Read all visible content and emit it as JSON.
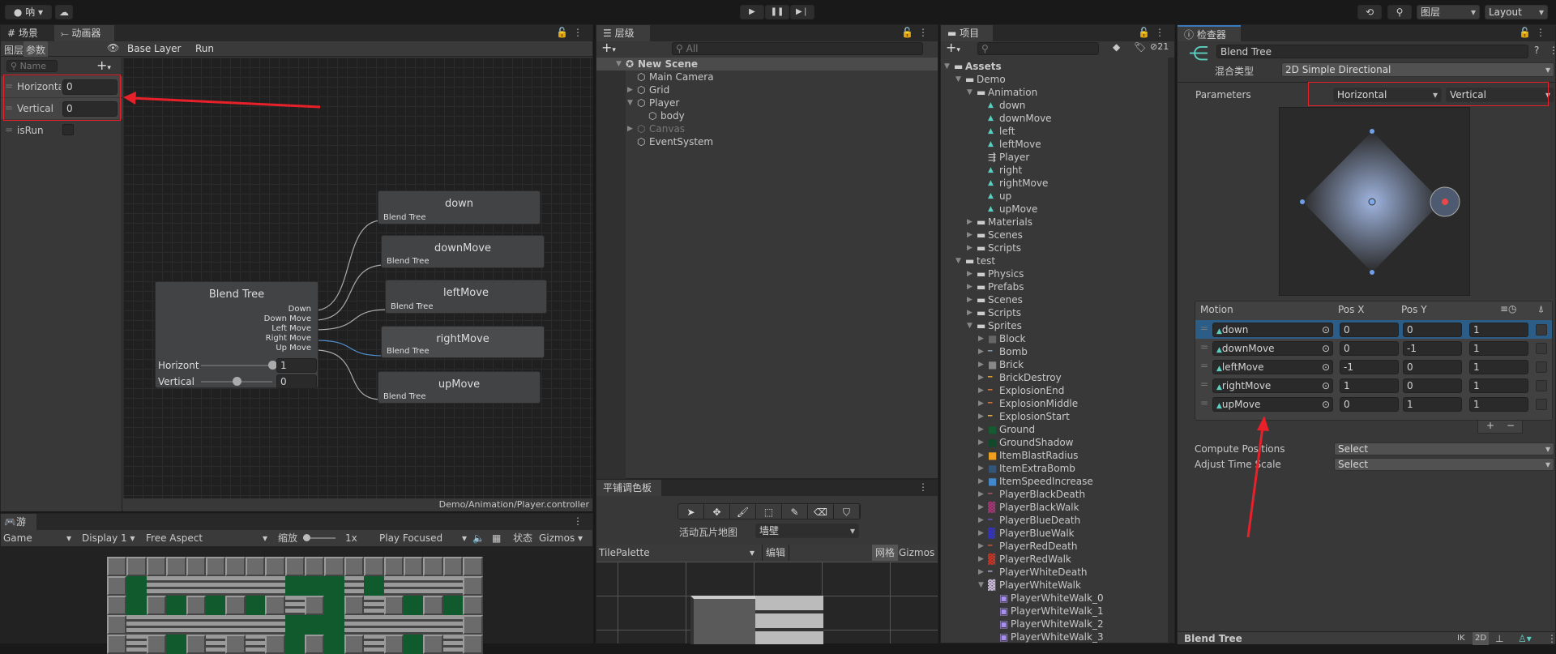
{
  "toolbar": {
    "account": "呐",
    "layers": "图层",
    "layout": "Layout",
    "play_icon": "play",
    "pause_icon": "pause",
    "step_icon": "step"
  },
  "animator": {
    "tabs": [
      "场景",
      "动画器"
    ],
    "subtabs": [
      "图层",
      "参数"
    ],
    "breadcrumb": [
      "Base Layer",
      "Run"
    ],
    "search_placeholder": "Name",
    "params": [
      {
        "name": "Horizontal",
        "value": "0"
      },
      {
        "name": "Vertical",
        "value": "0"
      },
      {
        "name": "isRun",
        "value": ""
      }
    ],
    "footer_path": "Demo/Animation/Player.controller",
    "blend_node": {
      "title": "Blend Tree",
      "outputs": [
        "Down",
        "Down Move",
        "Left Move",
        "Right Move",
        "Up Move"
      ],
      "sliders": [
        {
          "label": "Horizont",
          "value": "1",
          "fraction": 1
        },
        {
          "label": "Vertical",
          "value": "0",
          "fraction": 0.5
        }
      ]
    },
    "motion_nodes": [
      {
        "title": "down",
        "sub": "Blend Tree"
      },
      {
        "title": "downMove",
        "sub": "Blend Tree"
      },
      {
        "title": "leftMove",
        "sub": "Blend Tree"
      },
      {
        "title": "rightMove",
        "sub": "Blend Tree"
      },
      {
        "title": "upMove",
        "sub": "Blend Tree"
      }
    ]
  },
  "game": {
    "tab": "游戏",
    "display_mode": "Game",
    "display": "Display 1",
    "aspect": "Free Aspect",
    "scale_label": "缩放",
    "scale_value": "1x",
    "play_mode": "Play Focused",
    "stats": "状态",
    "gizmos": "Gizmos"
  },
  "hierarchy": {
    "tab": "层级",
    "search_placeholder": "All",
    "items": [
      {
        "label": "New Scene",
        "depth": 0,
        "arrow": "▼"
      },
      {
        "label": "Main Camera",
        "depth": 1,
        "arrow": ""
      },
      {
        "label": "Grid",
        "depth": 1,
        "arrow": "▶"
      },
      {
        "label": "Player",
        "depth": 1,
        "arrow": "▼"
      },
      {
        "label": "body",
        "depth": 2,
        "arrow": ""
      },
      {
        "label": "Canvas",
        "depth": 1,
        "arrow": "▶"
      },
      {
        "label": "EventSystem",
        "depth": 1,
        "arrow": ""
      }
    ]
  },
  "tile_palette": {
    "tab": "平铺调色板",
    "active_tilemap_label": "活动瓦片地图",
    "active_tilemap": "墙壁",
    "palette": "TilePalette",
    "edit": "编辑",
    "grid": "网格",
    "gizmos": "Gizmos",
    "tools": [
      "select",
      "move",
      "paint",
      "box-fill",
      "pick",
      "erase",
      "fill"
    ]
  },
  "project": {
    "tab": "项目",
    "hidden_count": "21",
    "items": [
      {
        "label": "Assets",
        "depth": 0,
        "arrow": "▼",
        "type": "folder"
      },
      {
        "label": "Demo",
        "depth": 1,
        "arrow": "▼",
        "type": "folder"
      },
      {
        "label": "Animation",
        "depth": 2,
        "arrow": "▼",
        "type": "folder"
      },
      {
        "label": "down",
        "depth": 3,
        "arrow": "",
        "type": "anim"
      },
      {
        "label": "downMove",
        "depth": 3,
        "arrow": "",
        "type": "anim"
      },
      {
        "label": "left",
        "depth": 3,
        "arrow": "",
        "type": "anim"
      },
      {
        "label": "leftMove",
        "depth": 3,
        "arrow": "",
        "type": "anim"
      },
      {
        "label": "Player",
        "depth": 3,
        "arrow": "",
        "type": "controller"
      },
      {
        "label": "right",
        "depth": 3,
        "arrow": "",
        "type": "anim"
      },
      {
        "label": "rightMove",
        "depth": 3,
        "arrow": "",
        "type": "anim"
      },
      {
        "label": "up",
        "depth": 3,
        "arrow": "",
        "type": "anim"
      },
      {
        "label": "upMove",
        "depth": 3,
        "arrow": "",
        "type": "anim"
      },
      {
        "label": "Materials",
        "depth": 2,
        "arrow": "▶",
        "type": "folder"
      },
      {
        "label": "Scenes",
        "depth": 2,
        "arrow": "▶",
        "type": "folder"
      },
      {
        "label": "Scripts",
        "depth": 2,
        "arrow": "▶",
        "type": "folder"
      },
      {
        "label": "test",
        "depth": 1,
        "arrow": "▼",
        "type": "folder"
      },
      {
        "label": "Physics",
        "depth": 2,
        "arrow": "▶",
        "type": "folder"
      },
      {
        "label": "Prefabs",
        "depth": 2,
        "arrow": "▶",
        "type": "folder"
      },
      {
        "label": "Scenes",
        "depth": 2,
        "arrow": "▶",
        "type": "folder"
      },
      {
        "label": "Scripts",
        "depth": 2,
        "arrow": "▶",
        "type": "folder"
      },
      {
        "label": "Sprites",
        "depth": 2,
        "arrow": "▼",
        "type": "folder"
      },
      {
        "label": "Block",
        "depth": 3,
        "arrow": "▶",
        "type": "sprite",
        "color": "#666666"
      },
      {
        "label": "Bomb",
        "depth": 3,
        "arrow": "▶",
        "type": "strip",
        "color": "#8899aa"
      },
      {
        "label": "Brick",
        "depth": 3,
        "arrow": "▶",
        "type": "sprite",
        "color": "#888888"
      },
      {
        "label": "BrickDestroy",
        "depth": 3,
        "arrow": "▶",
        "type": "strip",
        "color": "#e8a020"
      },
      {
        "label": "ExplosionEnd",
        "depth": 3,
        "arrow": "▶",
        "type": "strip",
        "color": "#e07030"
      },
      {
        "label": "ExplosionMiddle",
        "depth": 3,
        "arrow": "▶",
        "type": "strip",
        "color": "#e07030"
      },
      {
        "label": "ExplosionStart",
        "depth": 3,
        "arrow": "▶",
        "type": "strip",
        "color": "#f0b040"
      },
      {
        "label": "Ground",
        "depth": 3,
        "arrow": "▶",
        "type": "sprite",
        "color": "#155a30"
      },
      {
        "label": "GroundShadow",
        "depth": 3,
        "arrow": "▶",
        "type": "sprite",
        "color": "#104a28"
      },
      {
        "label": "ItemBlastRadius",
        "depth": 3,
        "arrow": "▶",
        "type": "sprite",
        "color": "#f0a020"
      },
      {
        "label": "ItemExtraBomb",
        "depth": 3,
        "arrow": "▶",
        "type": "sprite",
        "color": "#335577"
      },
      {
        "label": "ItemSpeedIncrease",
        "depth": 3,
        "arrow": "▶",
        "type": "sprite",
        "color": "#4488cc"
      },
      {
        "label": "PlayerBlackDeath",
        "depth": 3,
        "arrow": "▶",
        "type": "strip",
        "color": "#aa5566"
      },
      {
        "label": "PlayerBlackWalk",
        "depth": 3,
        "arrow": "▶",
        "type": "sheet",
        "color": "#aa3377"
      },
      {
        "label": "PlayerBlueDeath",
        "depth": 3,
        "arrow": "▶",
        "type": "strip",
        "color": "#6655cc"
      },
      {
        "label": "PlayerBlueWalk",
        "depth": 3,
        "arrow": "▶",
        "type": "sheet",
        "color": "#3333cc"
      },
      {
        "label": "PlayerRedDeath",
        "depth": 3,
        "arrow": "▶",
        "type": "strip",
        "color": "#cc5533"
      },
      {
        "label": "PlayerRedWalk",
        "depth": 3,
        "arrow": "▶",
        "type": "sheet",
        "color": "#cc3322"
      },
      {
        "label": "PlayerWhiteDeath",
        "depth": 3,
        "arrow": "▶",
        "type": "strip",
        "color": "#aaaacc"
      },
      {
        "label": "PlayerWhiteWalk",
        "depth": 3,
        "arrow": "▼",
        "type": "sheet",
        "color": "#ccbbdd"
      },
      {
        "label": "PlayerWhiteWalk_0",
        "depth": 4,
        "arrow": "",
        "type": "subsprite"
      },
      {
        "label": "PlayerWhiteWalk_1",
        "depth": 4,
        "arrow": "",
        "type": "subsprite"
      },
      {
        "label": "PlayerWhiteWalk_2",
        "depth": 4,
        "arrow": "",
        "type": "subsprite"
      },
      {
        "label": "PlayerWhiteWalk_3",
        "depth": 4,
        "arrow": "",
        "type": "subsprite"
      }
    ]
  },
  "inspector": {
    "tab": "检查器",
    "name": "Blend Tree",
    "blend_type_label": "混合类型",
    "blend_type": "2D Simple Directional",
    "parameters_label": "Parameters",
    "param_x": "Horizontal",
    "param_y": "Vertical",
    "table_headers": {
      "motion": "Motion",
      "pos_x": "Pos X",
      "pos_y": "Pos Y"
    },
    "motions": [
      {
        "name": "down",
        "x": "0",
        "y": "0",
        "speed": "1"
      },
      {
        "name": "downMove",
        "x": "0",
        "y": "-1",
        "speed": "1"
      },
      {
        "name": "leftMove",
        "x": "-1",
        "y": "0",
        "speed": "1"
      },
      {
        "name": "rightMove",
        "x": "1",
        "y": "0",
        "speed": "1"
      },
      {
        "name": "upMove",
        "x": "0",
        "y": "1",
        "speed": "1"
      }
    ],
    "compute_positions_label": "Compute Positions",
    "compute_positions": "Select",
    "adjust_time_label": "Adjust Time Scale",
    "adjust_time": "Select",
    "preview_title": "Blend Tree",
    "preview_buttons": [
      "IK",
      "2D"
    ]
  },
  "colors": {
    "accent": "#2c5d87",
    "annotation": "#e8202a",
    "anim_icon": "#5ad0c0"
  }
}
